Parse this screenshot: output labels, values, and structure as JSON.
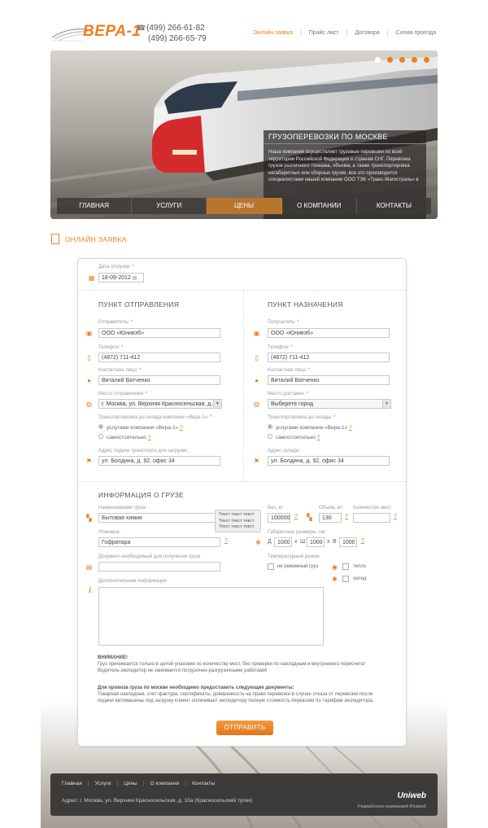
{
  "header": {
    "brand": "ВЕРА-1",
    "phone_1": "(499) 266-61-82",
    "phone_2": "(499) 266-65-79",
    "nav": [
      {
        "label": "Онлайн заявка",
        "active": true
      },
      {
        "label": "Прайс лист"
      },
      {
        "label": "Договора"
      },
      {
        "label": "Схема проезда"
      }
    ]
  },
  "hero": {
    "caption_title": "ГРУЗОПЕРЕВОЗКИ ПО МОСКВЕ",
    "caption_text": "Наша компания осуществляет грузовые перевозки по всей территории Российской Федерации и странам СНГ. Перевозка грузов различного тоннажа, объема, а также транспортировка негабаритных или сборных грузов, все это производится специалистами нашей компании ООО ТЭК «Транс-Магистраль» в",
    "slides_total": 5,
    "slide_active": 1,
    "main_nav": [
      {
        "label": "ГЛАВНАЯ"
      },
      {
        "label": "УСЛУГИ"
      },
      {
        "label": "ЦЕНЫ",
        "active": true
      },
      {
        "label": "О КОМПАНИИ"
      },
      {
        "label": "КОНТАКТЫ"
      }
    ]
  },
  "section_title": "ОНЛАЙН ЗАЯВКА",
  "form": {
    "ship_date_label": "Дата отгрузки:",
    "ship_date_value": "18-09-2012",
    "req": "*",
    "sender": {
      "title": "ПУНКТ ОТПРАВЛЕНИЯ",
      "name_label": "Отправитель:",
      "name_value": "ООО «Юнивэб»",
      "phone_label": "Телефон:",
      "phone_value": "(4872) 711-412",
      "contact_label": "Контактное лицо:",
      "contact_value": "Виталий Ватченко",
      "place_label": "Место отправления:",
      "place_value": "г. Москва, ул. Верхняя Красносельская, д.",
      "transport_label": "Транспортировка до склада компании «Вера-1»:",
      "radio_1": "услугами компании «Вера-1»",
      "radio_2": "самостоятельно",
      "address_label": "Адрес подачи транспорта для загрузки:",
      "address_value": "ул. Болдина, д. 92, офис 34"
    },
    "receiver": {
      "title": "ПУНКТ НАЗНАЧЕНИЯ",
      "name_label": "Получатель:",
      "name_value": "ООО «Юнивэб»",
      "phone_label": "Телефон:",
      "phone_value": "(4872) 711-412",
      "contact_label": "Контактное лицо:",
      "contact_value": "Виталий Ватченко",
      "place_label": "Место доставки:",
      "place_value": "Выберете город",
      "transport_label": "Транспортировка до склада:",
      "radio_1": "услугами компании «Вера-1»",
      "radio_2": "самостоятельно",
      "address_label": "Адрес склада:",
      "address_value": "ул. Болдина, д. 92, офис 34"
    },
    "cargo": {
      "title": "ИНФОРМАЦИЯ О ГРУЗЕ",
      "name_label": "Наименование груза:",
      "name_value": "Бытовая химия",
      "weight_label": "Вес, кг:",
      "weight_value": "100000",
      "volume_label": "Объем, м³:",
      "volume_value": "130",
      "count_label": "Количество мест",
      "count_value": "",
      "tooltip_1": "Текст текст текст",
      "tooltip_2": "Текст текст текст",
      "tooltip_3": "Текст текст текст",
      "pack_label": "Упаковка:",
      "pack_value": "Гофратара",
      "dims_label": "Габаритные размеры, см:",
      "dim_d_label": "Д",
      "dim_d": "1000",
      "dim_x1": "х",
      "dim_w_label": "Ш",
      "dim_w": "1000",
      "dim_x2": "х",
      "dim_h_label": "В",
      "dim_h": "1000",
      "temp_label": "Температурный режим",
      "temp_normal": "не режимный груз",
      "temp_warm": "тепло",
      "temp_cold": "холод",
      "doc_label": "Документ необходимый для получения груза",
      "info_label": "Дополнительная информация",
      "q": "?"
    },
    "notice_title": "ВНИМАНИЕ!",
    "notice_text": "Груз принимается только в целой упаковке по количеству мест, без проверки по накладным и внутреннего пересчета! Водитель-экспедитор не занимается погрузочно-разгрузочными работами!",
    "docs_title": "Для провоза груза по москве необходимо предоставить следующие документы:",
    "docs_text": "Товарная накладная, счет-фактура, сертификаты, доверенность на право перевозки в случае отказа от перевозки после подачи автомашины под загрузку клиент оплачивает экспедитору полную стоимость перевозки по тарифам экспедитора.",
    "submit": "ОТПРАВИТЬ"
  },
  "footer": {
    "nav": [
      {
        "label": "Главная"
      },
      {
        "label": "Услуги"
      },
      {
        "label": "Цены"
      },
      {
        "label": "О компании"
      },
      {
        "label": "Контакты"
      }
    ],
    "address": "Адрес: г. Москва, ул. Верхняя Красносельская, д. 10а (Красносельский тупик)",
    "logo": "Uniweb",
    "developer": "Разработано компанией Юнивэб"
  },
  "colors": {
    "accent": "#f07d1c",
    "active_tab": "#b8752d",
    "footer_bg": "#3d3b39"
  }
}
